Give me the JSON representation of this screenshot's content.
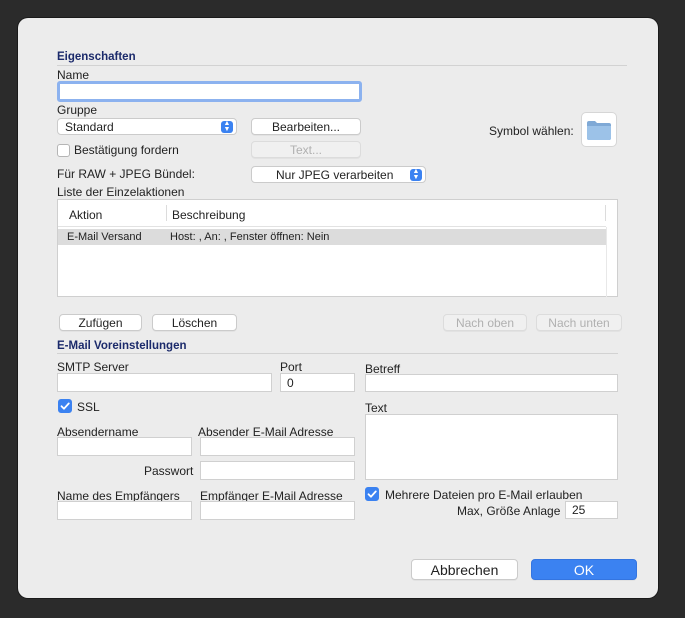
{
  "properties": {
    "section_title": "Eigenschaften",
    "name_label": "Name",
    "name_value": "",
    "group_label": "Gruppe",
    "group_value": "Standard",
    "edit_button": "Bearbeiten...",
    "symbol_label": "Symbol wählen:",
    "symbol_icon": "folder-icon",
    "confirm_label": "Bestätigung fordern",
    "confirm_checked": false,
    "text_button": "Text...",
    "raw_label": "Für RAW + JPEG Bündel:",
    "raw_value": "Nur JPEG verarbeiten",
    "actions_label": "Liste der Einzelaktionen"
  },
  "actions_table": {
    "columns": [
      "Aktion",
      "Beschreibung"
    ],
    "rows": [
      {
        "action": "E-Mail Versand",
        "description": "Host: , An: , Fenster öffnen: Nein"
      }
    ]
  },
  "action_buttons": {
    "add": "Zufügen",
    "delete": "Löschen",
    "move_up": "Nach oben",
    "move_down": "Nach unten"
  },
  "email": {
    "section_title": "E-Mail Voreinstellungen",
    "smtp_label": "SMTP Server",
    "smtp_value": "",
    "port_label": "Port",
    "port_value": "0",
    "subject_label": "Betreff",
    "subject_value": "",
    "ssl_label": "SSL",
    "ssl_checked": true,
    "text_label": "Text",
    "text_value": "",
    "sender_name_label": "Absendername",
    "sender_name_value": "",
    "sender_email_label": "Absender E-Mail Adresse",
    "sender_email_value": "",
    "password_label": "Passwort",
    "password_value": "",
    "recipient_name_label": "Name des Empfängers",
    "recipient_name_value": "",
    "recipient_email_label": "Empfänger E-Mail Adresse",
    "recipient_email_value": "",
    "multi_files_label": "Mehrere Dateien pro E-Mail erlauben",
    "multi_files_checked": true,
    "max_size_label": "Max, Größe Anlage",
    "max_size_value": "25"
  },
  "footer": {
    "cancel": "Abbrechen",
    "ok": "OK"
  },
  "colors": {
    "accent": "#3b82f1",
    "section_title": "#1b2a6b",
    "background": "#ececec"
  }
}
